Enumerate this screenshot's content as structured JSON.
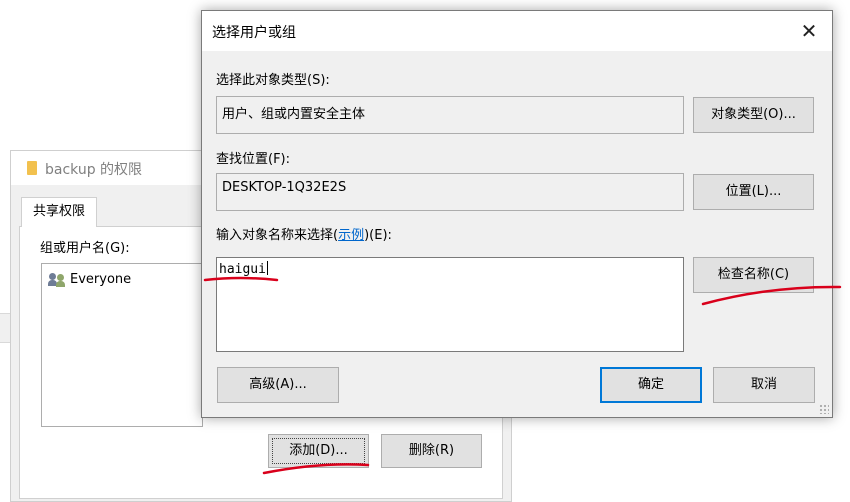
{
  "background_window": {
    "title": "backup 的权限",
    "tab_share": "共享权限",
    "group_label": "组或用户名(G):",
    "list_items": [
      {
        "name": "Everyone"
      }
    ],
    "add_button": "添加(D)...",
    "remove_button": "删除(R)"
  },
  "dialog": {
    "title": "选择用户或组",
    "object_type_label": "选择此对象类型(S):",
    "object_type_value": "用户、组或内置安全主体",
    "object_type_button": "对象类型(O)...",
    "location_label": "查找位置(F):",
    "location_value": "DESKTOP-1Q32E2S",
    "location_button": "位置(L)...",
    "enter_names_label_prefix": "输入对象名称来选择(",
    "enter_names_label_link": "示例",
    "enter_names_label_suffix": ")(E):",
    "names_value": "haigui",
    "check_names_button": "检查名称(C)",
    "advanced_button": "高级(A)...",
    "ok_button": "确定",
    "cancel_button": "取消"
  },
  "colors": {
    "annotation_red": "#d9001b",
    "primary_border": "#0078d7",
    "link": "#0066cc"
  }
}
